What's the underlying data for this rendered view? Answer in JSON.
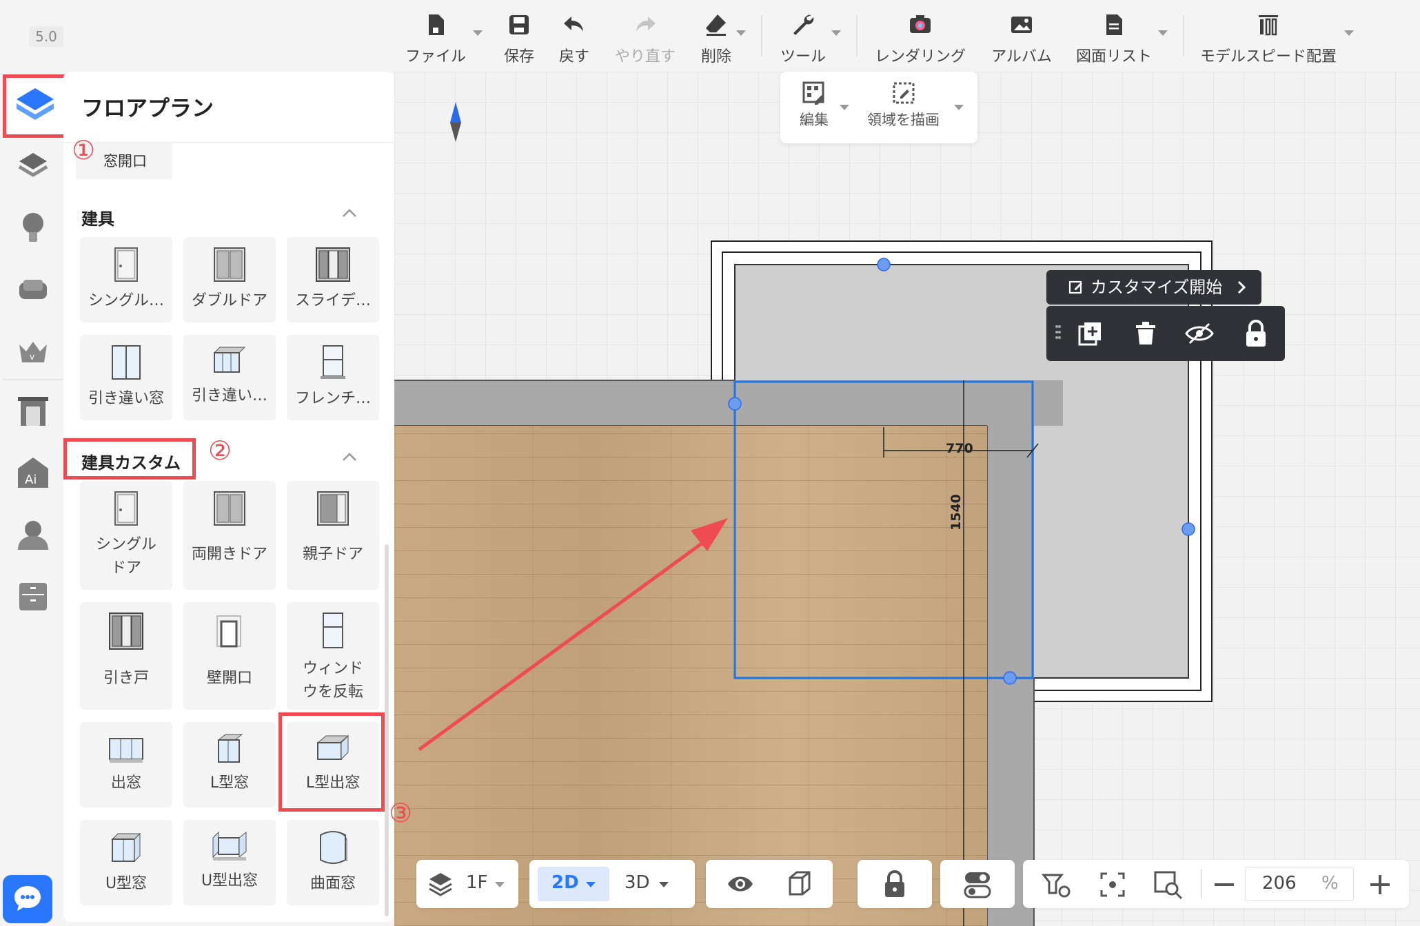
{
  "app": {
    "version": "5.0"
  },
  "toolbar": {
    "items": [
      {
        "label": "ファイル",
        "icon": "file-icon"
      },
      {
        "label": "保存",
        "icon": "save-icon"
      },
      {
        "label": "戻す",
        "icon": "undo-icon"
      },
      {
        "label": "やり直す",
        "icon": "redo-icon"
      },
      {
        "label": "削除",
        "icon": "eraser-icon"
      },
      {
        "label": "ツール",
        "icon": "wrench-icon"
      },
      {
        "label": "レンダリング",
        "icon": "camera-icon"
      },
      {
        "label": "アルバム",
        "icon": "album-icon"
      },
      {
        "label": "図面リスト",
        "icon": "document-icon"
      },
      {
        "label": "モデルスピード配置",
        "icon": "speed-place-icon"
      }
    ]
  },
  "edit_bar": {
    "edit_label": "編集",
    "draw_area_label": "領域を描画"
  },
  "panel": {
    "title": "フロアプラン",
    "top_chip": "窓開口",
    "sections": [
      {
        "title": "建具",
        "items": [
          "シングル…",
          "ダブルドア",
          "スライデ…",
          "引き違い窓",
          "引き違い…",
          "フレンチ…"
        ]
      },
      {
        "title": "建具カスタム",
        "items": [
          "シングルドア",
          "両開きドア",
          "親子ドア",
          "引き戸",
          "壁開口",
          "ウィンドウを反転",
          "出窓",
          "L型窓",
          "L型出窓",
          "U型窓",
          "U型出窓",
          "曲面窓"
        ]
      }
    ]
  },
  "annotations": {
    "step1": "①",
    "step2": "②",
    "step3": "③"
  },
  "canvas": {
    "dim_width": "770",
    "dim_height": "1540",
    "custom_start_label": "カスタマイズ開始"
  },
  "bottom_bar": {
    "floor": "1F",
    "view_2d": "2D",
    "view_3d": "3D",
    "zoom": "206",
    "zoom_unit": "%"
  },
  "colors": {
    "accent": "#2a77ff",
    "annotation": "#ef4b52",
    "selection": "#1a73e8"
  }
}
